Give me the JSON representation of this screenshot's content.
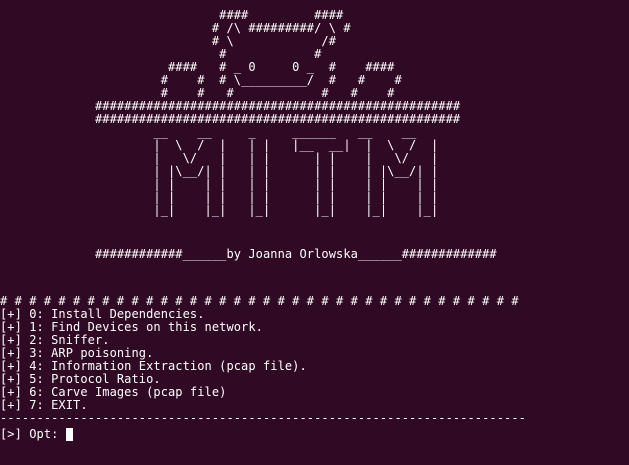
{
  "theme": {
    "background": "#300a24",
    "foreground": "#ffffff"
  },
  "banner": [
    "                              ####         ####",
    "                             # /\\ #########/ \\ #",
    "                             # \\            /# ",
    "                              #            #   ",
    "                       ####   # _ 0     0 _  #    ####",
    "                      #    #  # \\_________/  #   #    #",
    "                      #    #   #            #   #    #",
    "             ##################################################",
    "             ##################################################",
    "                     __    __     _     ______   __    __",
    "                     |  \\  /  |   | |   |__  __|  |  \\  /  |",
    "                     |   \\/   |   | |      | |    |   \\/   |",
    "                     | |\\__/| |   | |      | |    | |\\__/| |",
    "                     | |    | |   | |      | |    | |    | |",
    "                     | |    | |   | |      | |    | |    | |",
    "                     |_|    |_|   |_|      |_|    |_|    |_|",
    "             ############______by Joanna Orlowska______#############"
  ],
  "menu": {
    "separator_top": "# # # # # # # # # # # # # # # # # # # # # # # # # # # # # # # # # # # #",
    "items": [
      "[+] 0: Install Dependencies.",
      "[+] 1: Find Devices on this network.",
      "[+] 2: Sniffer.",
      "[+] 3: ARP poisoning.",
      "[+] 4: Information Extraction (pcap file).",
      "[+] 5: Protocol Ratio.",
      "[+] 6: Carve Images (pcap file)",
      "[+] 7: EXIT."
    ],
    "separator_bottom": "------------------------------------------------------------------------",
    "prompt": "[>] Opt: "
  }
}
